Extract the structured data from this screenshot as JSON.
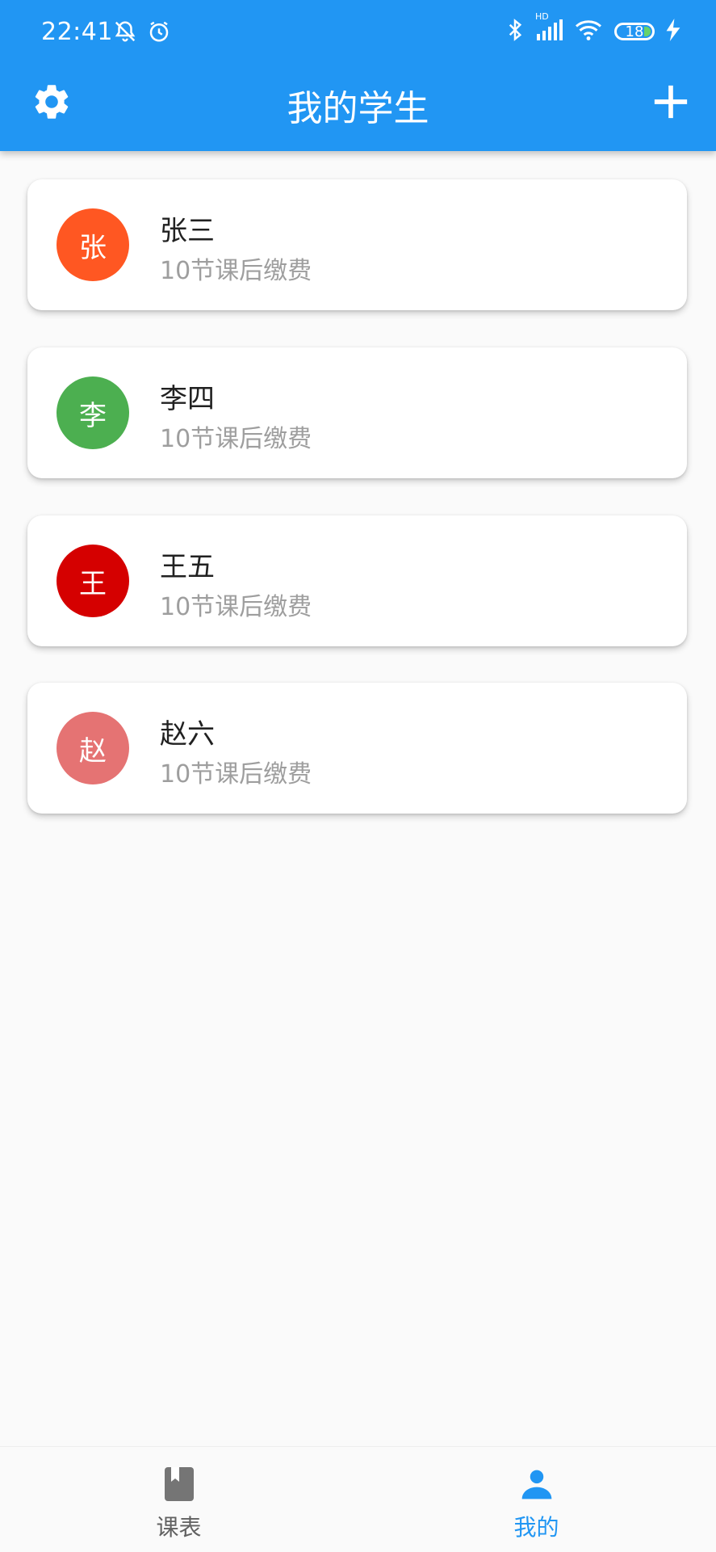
{
  "status_bar": {
    "time": "22:41",
    "hd_label": "HD",
    "battery_level": "18"
  },
  "app_bar": {
    "title": "我的学生",
    "settings_icon": "gear-icon",
    "add_icon": "plus-icon"
  },
  "students": [
    {
      "initial": "张",
      "name": "张三",
      "subtitle": "10节课后缴费",
      "avatar_color": "#ff5722"
    },
    {
      "initial": "李",
      "name": "李四",
      "subtitle": "10节课后缴费",
      "avatar_color": "#4caf50"
    },
    {
      "initial": "王",
      "name": "王五",
      "subtitle": "10节课后缴费",
      "avatar_color": "#d50000"
    },
    {
      "initial": "赵",
      "name": "赵六",
      "subtitle": "10节课后缴费",
      "avatar_color": "#e57373"
    }
  ],
  "bottom_nav": {
    "items": [
      {
        "label": "课表",
        "icon": "book-icon",
        "active": false
      },
      {
        "label": "我的",
        "icon": "person-icon",
        "active": true
      }
    ],
    "active_color": "#2196f3",
    "inactive_color": "#616161"
  }
}
